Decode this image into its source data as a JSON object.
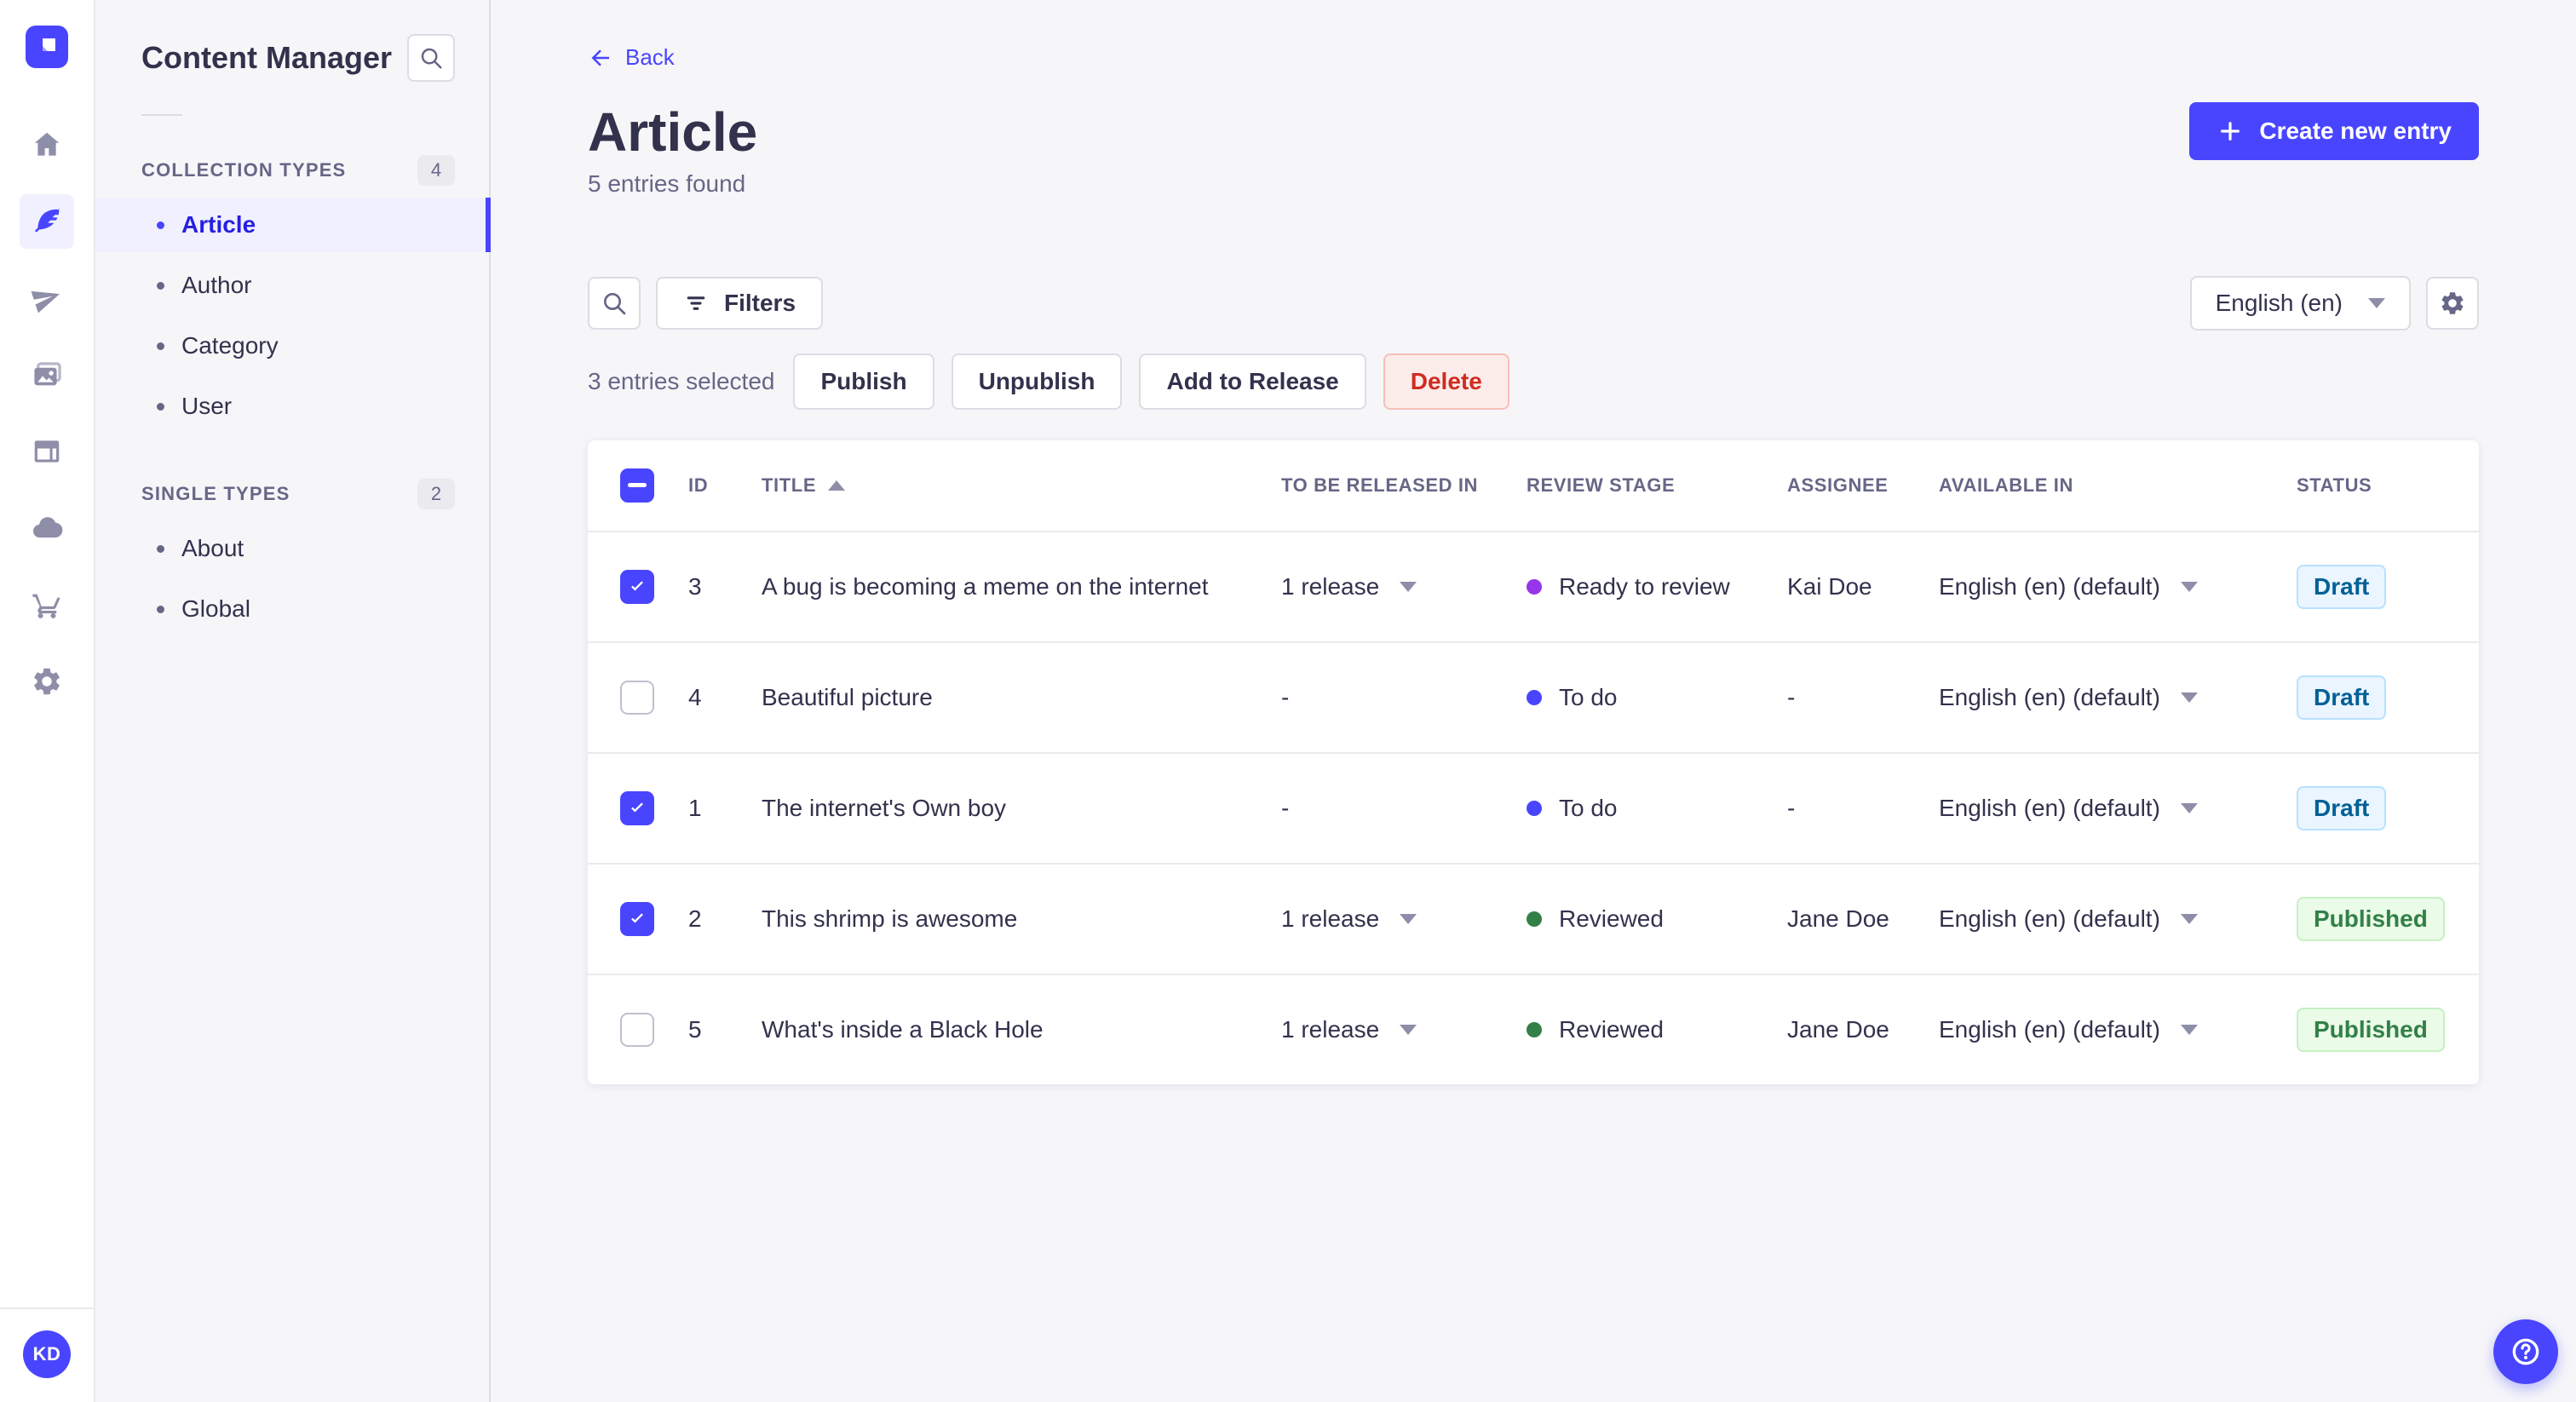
{
  "colors": {
    "primary": "#4945ff",
    "primary_dark": "#271fe0",
    "text_dark": "#32324d",
    "text_muted": "#666687",
    "border": "#dcdce4",
    "row_divider": "#eaeaef",
    "draft_bg": "#eaf5ff",
    "draft_border": "#b8e1ff",
    "draft_text": "#006096",
    "published_bg": "#eafbe7",
    "published_border": "#c6f0c2",
    "published_text": "#328048",
    "danger_bg": "#fcecea",
    "danger_border": "#f5c0b8",
    "danger_text": "#d02b20",
    "stage_ready": "#9736e8",
    "stage_todo": "#4945ff",
    "stage_reviewed": "#328048"
  },
  "rail": {
    "logo_icon": "strapi-logo",
    "icons": [
      "home-icon",
      "feather-icon",
      "paper-plane-icon",
      "images-icon",
      "layout-icon",
      "cloud-icon",
      "cart-icon",
      "gear-icon"
    ],
    "active_icon": "feather-icon",
    "user_initials": "KD"
  },
  "subnav": {
    "title": "Content Manager",
    "search_icon": "search-icon",
    "sections": [
      {
        "label": "COLLECTION TYPES",
        "count": "4",
        "items": [
          {
            "label": "Article",
            "active": true
          },
          {
            "label": "Author"
          },
          {
            "label": "Category"
          },
          {
            "label": "User"
          }
        ]
      },
      {
        "label": "SINGLE TYPES",
        "count": "2",
        "items": [
          {
            "label": "About"
          },
          {
            "label": "Global"
          }
        ]
      }
    ]
  },
  "header": {
    "back_label": "Back",
    "title": "Article",
    "subtitle": "5 entries found",
    "create_button_label": "Create new entry"
  },
  "toolbar": {
    "filters_label": "Filters",
    "locale_value": "English (en)"
  },
  "selection": {
    "text": "3 entries selected",
    "publish_label": "Publish",
    "unpublish_label": "Unpublish",
    "add_to_release_label": "Add to Release",
    "delete_label": "Delete"
  },
  "table": {
    "columns": [
      "ID",
      "TITLE",
      "TO BE RELEASED IN",
      "REVIEW STAGE",
      "ASSIGNEE",
      "AVAILABLE IN",
      "STATUS"
    ],
    "sorted_column": "TITLE",
    "header_checkbox_state": "indeterminate",
    "rows": [
      {
        "checked": true,
        "id": "3",
        "title": "A bug is becoming a meme on the internet",
        "release": "1 release",
        "review_stage": "Ready to review",
        "review_color": "#9736e8",
        "assignee": "Kai Doe",
        "available_in": "English (en) (default)",
        "status": "Draft",
        "status_variant": "draft"
      },
      {
        "checked": false,
        "id": "4",
        "title": "Beautiful picture",
        "release": "-",
        "review_stage": "To do",
        "review_color": "#4945ff",
        "assignee": "-",
        "available_in": "English (en) (default)",
        "status": "Draft",
        "status_variant": "draft"
      },
      {
        "checked": true,
        "id": "1",
        "title": "The internet's Own boy",
        "release": "-",
        "review_stage": "To do",
        "review_color": "#4945ff",
        "assignee": "-",
        "available_in": "English (en) (default)",
        "status": "Draft",
        "status_variant": "draft"
      },
      {
        "checked": true,
        "id": "2",
        "title": "This shrimp is awesome",
        "release": "1 release",
        "review_stage": "Reviewed",
        "review_color": "#328048",
        "assignee": "Jane Doe",
        "available_in": "English (en) (default)",
        "status": "Published",
        "status_variant": "published"
      },
      {
        "checked": false,
        "id": "5",
        "title": "What's inside a Black Hole",
        "release": "1 release",
        "review_stage": "Reviewed",
        "review_color": "#328048",
        "assignee": "Jane Doe",
        "available_in": "English (en) (default)",
        "status": "Published",
        "status_variant": "published"
      }
    ]
  },
  "fab": {
    "help_icon": "question-circle-icon"
  }
}
